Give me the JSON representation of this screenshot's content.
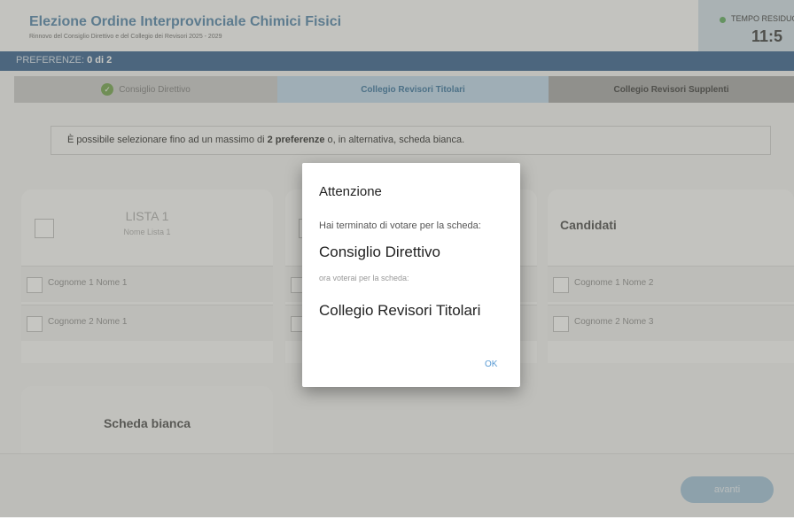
{
  "header": {
    "title": "Elezione Ordine Interprovinciale Chimici Fisici",
    "subtitle": "Rinnovo del Consiglio Direttivo e del Collegio dei Revisori 2025 - 2029",
    "timer_label": "TEMPO RESIDUO",
    "timer_value": "11:5"
  },
  "preferences": {
    "label": "PREFERENZE:",
    "count": "0 di 2"
  },
  "tabs": [
    {
      "label": "Consiglio Direttivo",
      "status": "completed"
    },
    {
      "label": "Collegio Revisori Titolari",
      "status": "active"
    },
    {
      "label": "Collegio Revisori Supplenti",
      "status": "pending"
    }
  ],
  "info": {
    "prefix": "È possibile selezionare fino ad un massimo di ",
    "bold": "2 preferenze",
    "suffix": " o, in alternativa, scheda bianca."
  },
  "lists": [
    {
      "title": "LISTA 1",
      "subtitle": "Nome Lista 1",
      "candidates": [
        "Cognome 1 Nome 1",
        "Cognome 2 Nome 1"
      ]
    },
    {
      "title": "Candidati",
      "candidates": [
        "Cognome 1 Nome 2",
        "Cognome 2 Nome 3"
      ]
    }
  ],
  "blank_ballot": "Scheda bianca",
  "footer": {
    "next_label": "avanti"
  },
  "dialog": {
    "title": "Attenzione",
    "body1": "Hai terminato di votare per la scheda:",
    "ballot_done": "Consiglio Direttivo",
    "body2": "ora voterai per la scheda:",
    "ballot_next": "Collegio Revisori Titolari",
    "ok_label": "OK"
  },
  "colors": {
    "accent": "#2d5b8a",
    "title": "#4a7fa6",
    "success": "#6b9f46",
    "link": "#5a9bd4"
  }
}
